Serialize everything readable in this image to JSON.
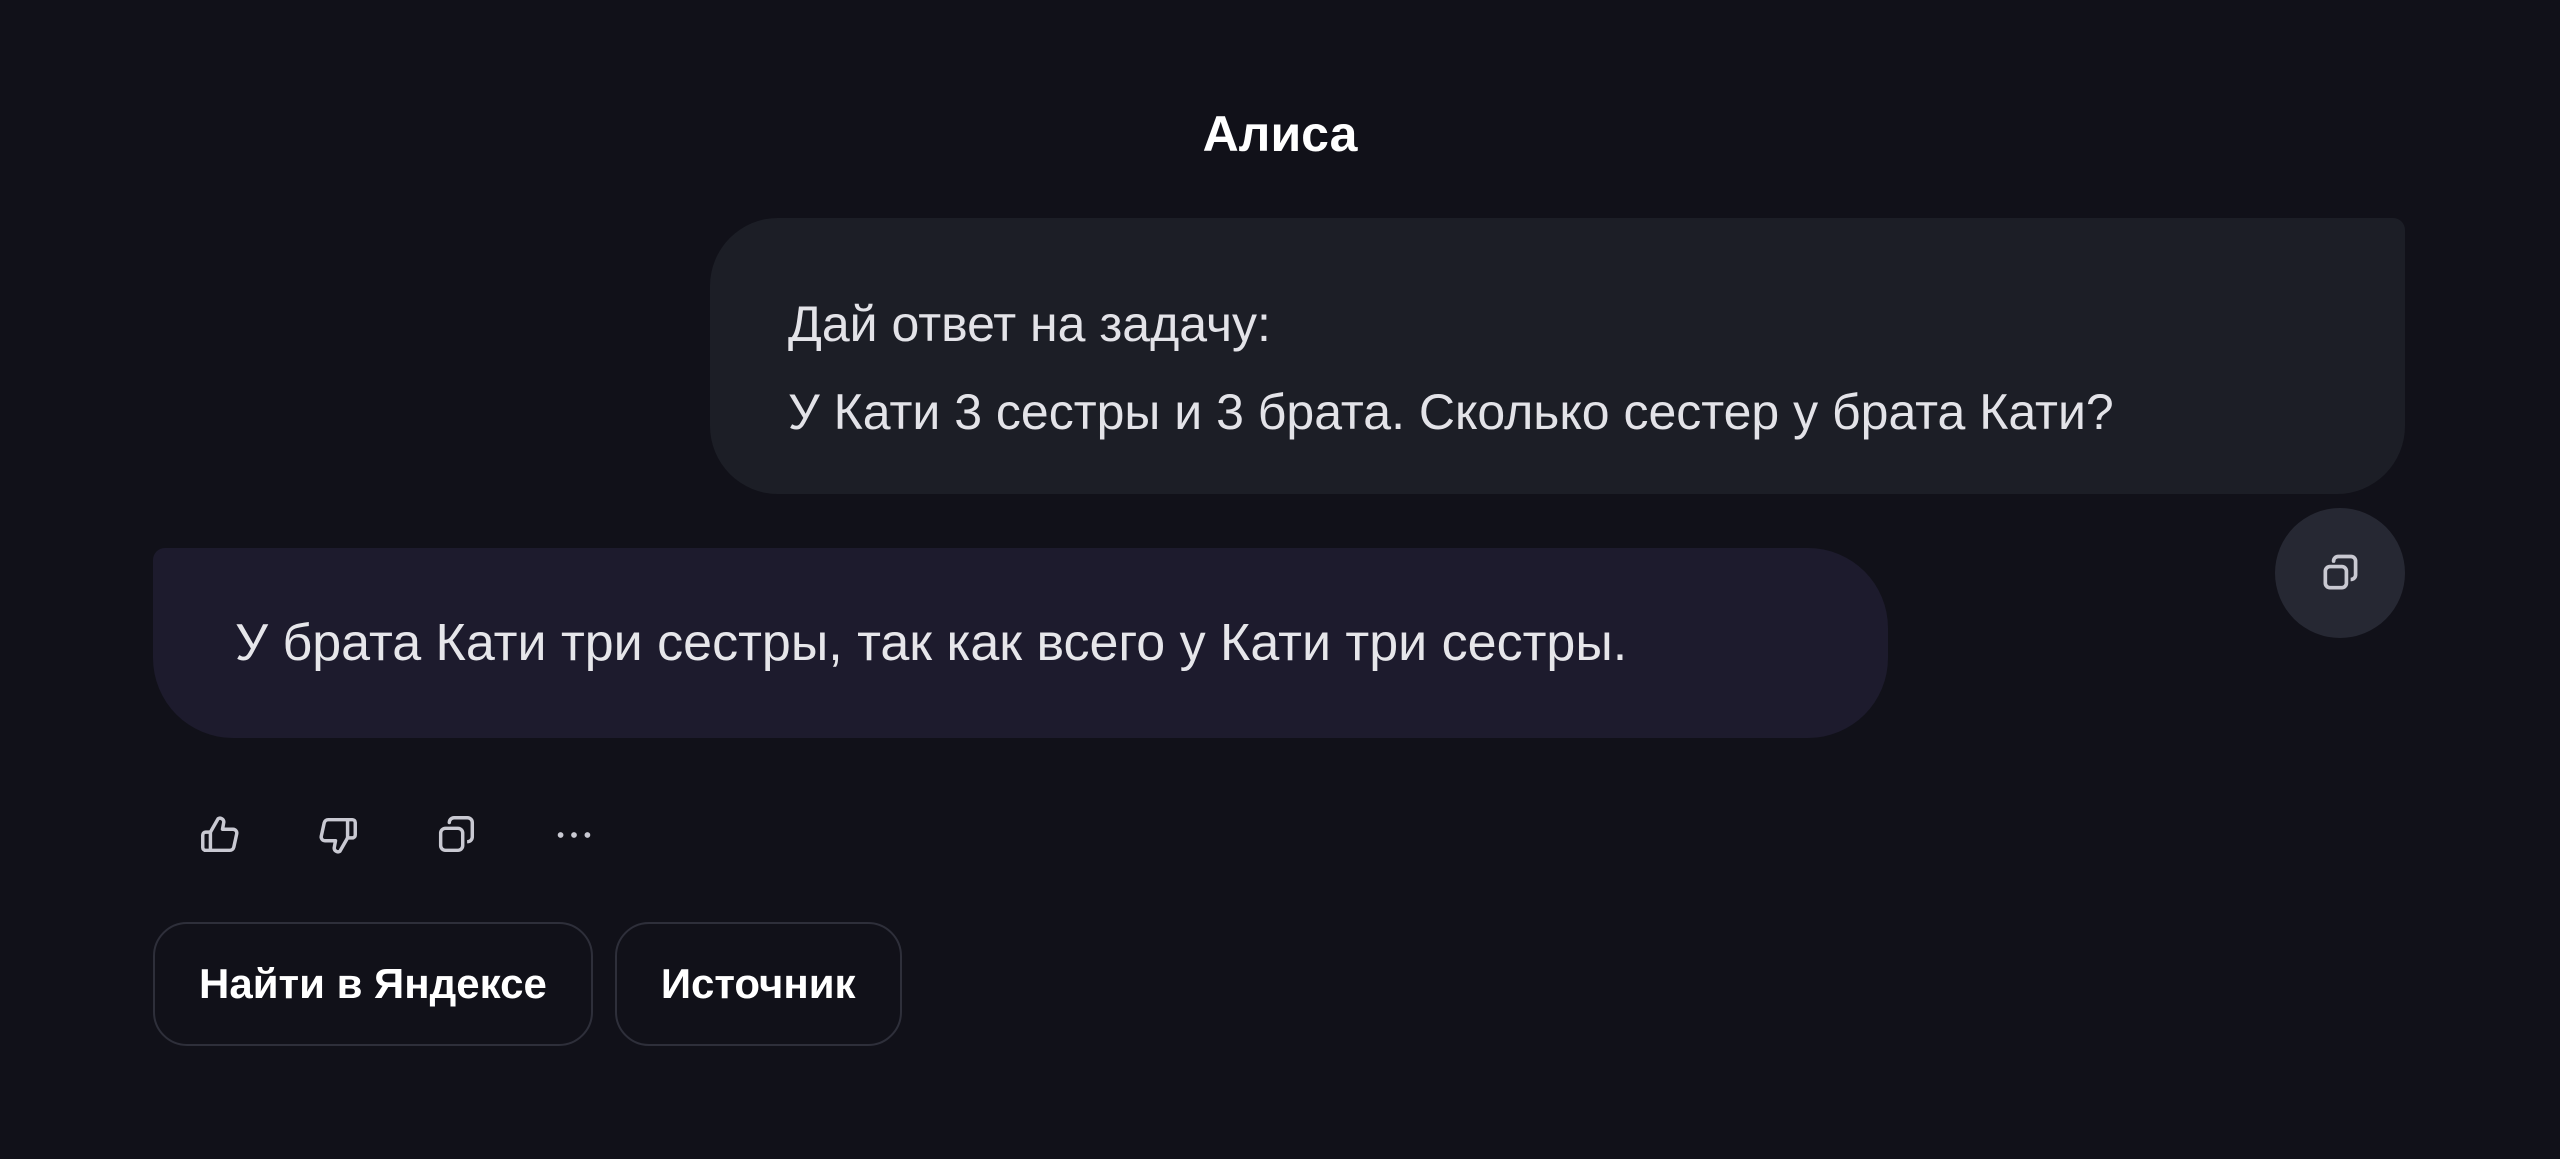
{
  "header": {
    "title": "Алиса"
  },
  "conversation": {
    "user_message": {
      "line1": "Дай ответ на задачу:",
      "line2": "У Кати 3 сестры и 3 брата. Сколько сестер у брата Кати?"
    },
    "assistant_message": {
      "text": "У брата Кати три сестры, так как всего у Кати три сестры."
    }
  },
  "icons": {
    "user_copy": "copy-icon",
    "like": "thumbs-up-icon",
    "dislike": "thumbs-down-icon",
    "copy": "copy-icon",
    "more": "more-horizontal-icon"
  },
  "suggestions": [
    {
      "label": "Найти в Яндексе"
    },
    {
      "label": "Источник"
    }
  ],
  "colors": {
    "background": "#111119",
    "user_bubble": "#1c1e26",
    "assistant_bubble": "#1d1b2d",
    "chip_border": "#2e2f3a"
  }
}
